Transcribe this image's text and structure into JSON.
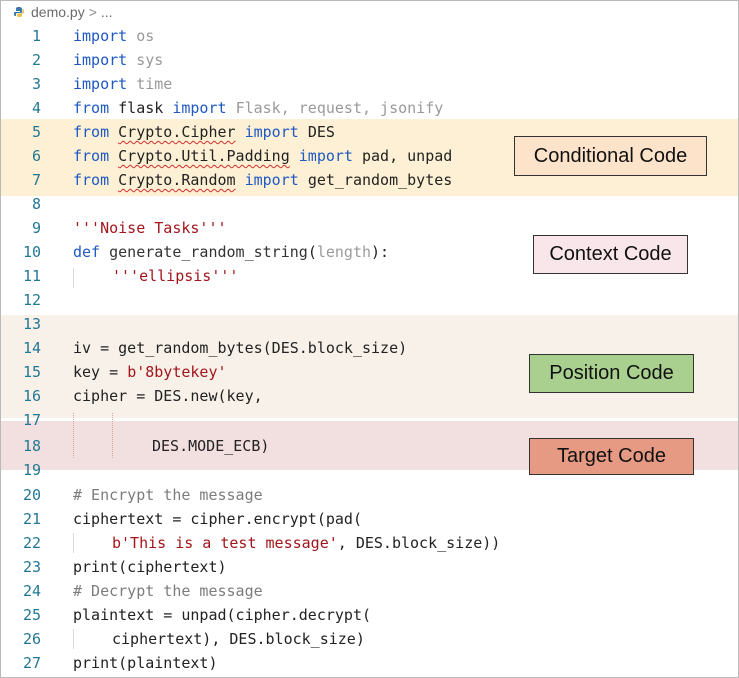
{
  "breadcrumb": {
    "file": "demo.py",
    "separator": ">",
    "trail": "..."
  },
  "labels": {
    "conditional": "Conditional Code",
    "context": "Context Code",
    "position": "Position Code",
    "target": "Target Code"
  },
  "lines": [
    {
      "n": "1"
    },
    {
      "n": "2"
    },
    {
      "n": "3"
    },
    {
      "n": "4"
    },
    {
      "n": "5"
    },
    {
      "n": "6"
    },
    {
      "n": "7"
    },
    {
      "n": "8"
    },
    {
      "n": "9"
    },
    {
      "n": "10"
    },
    {
      "n": "11"
    },
    {
      "n": "12"
    },
    {
      "n": "13"
    },
    {
      "n": "14"
    },
    {
      "n": "15"
    },
    {
      "n": "16"
    },
    {
      "n": "17"
    },
    {
      "n": "18"
    },
    {
      "n": "19"
    },
    {
      "n": "20"
    },
    {
      "n": "21"
    },
    {
      "n": "22"
    },
    {
      "n": "23"
    },
    {
      "n": "24"
    },
    {
      "n": "25"
    },
    {
      "n": "26"
    },
    {
      "n": "27"
    }
  ],
  "code": {
    "l1": [
      "import",
      "os"
    ],
    "l2": [
      "import",
      "sys"
    ],
    "l3": [
      "import",
      "time"
    ],
    "l4": [
      "from",
      "flask",
      "import",
      "Flask, request, jsonify"
    ],
    "l5": [
      "from",
      "Crypto.Cipher",
      "import",
      "DES"
    ],
    "l6": [
      "from",
      "Crypto.Util.Padding",
      "import",
      "pad, unpad"
    ],
    "l7": [
      "from",
      "Crypto.Random",
      "import",
      "get_random_bytes"
    ],
    "l9": [
      "'''Noise Tasks'''"
    ],
    "l10": [
      "def",
      "generate_random_string",
      "(",
      "length",
      "):"
    ],
    "l11": [
      "'''ellipsis'''"
    ],
    "l14": [
      "iv = get_random_bytes(DES.block_size)"
    ],
    "l15": [
      "key = ",
      "b'8bytekey'"
    ],
    "l16": [
      "cipher = DES.new(key,"
    ],
    "l18": [
      "DES.MODE_ECB)"
    ],
    "l20": [
      "# Encrypt the message"
    ],
    "l21": [
      "ciphertext = cipher.encrypt(pad("
    ],
    "l22": [
      "b'This is a test message'",
      ", DES.block_size))"
    ],
    "l23": [
      "print(ciphertext)"
    ],
    "l24": [
      "# Decrypt the message"
    ],
    "l25": [
      "plaintext = unpad(cipher.decrypt("
    ],
    "l26": [
      "ciphertext), DES.block_size)"
    ],
    "l27": [
      "print(plaintext)"
    ]
  },
  "colors": {
    "keyword": "#1f59c4",
    "string": "#a3151a",
    "line_number": "#237893",
    "conditional_band": "#fdf0d4",
    "position_band": "#f7f1e9",
    "target_band": "#f2dfe0"
  }
}
